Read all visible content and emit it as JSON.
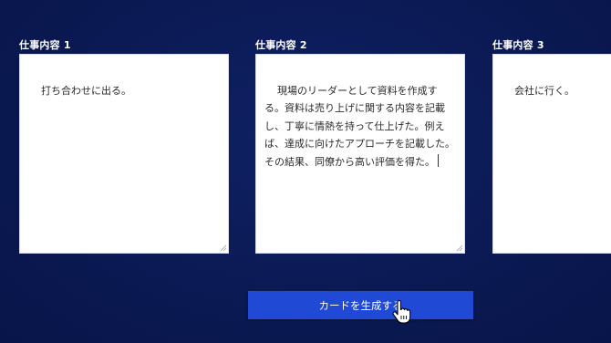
{
  "fields": [
    {
      "label": "仕事内容 1",
      "value": "打ち合わせに出る。"
    },
    {
      "label": "仕事内容 2",
      "value": "現場のリーダーとして資料を作成する。資料は売り上げに関する内容を記載し、丁寧に情熱を持って仕上げた。例えば、達成に向けたアプローチを記載した。その結果、同僚から高い評価を得た。"
    },
    {
      "label": "仕事内容 3",
      "value": "会社に行く。"
    }
  ],
  "generate_button": {
    "label": "カードを生成する"
  },
  "colors": {
    "background": "#0b1a55",
    "button": "#2049d6",
    "textarea": "#ffffff"
  },
  "icons": {
    "cursor": "hand-pointer-icon",
    "resize": "resize-handle-icon"
  }
}
